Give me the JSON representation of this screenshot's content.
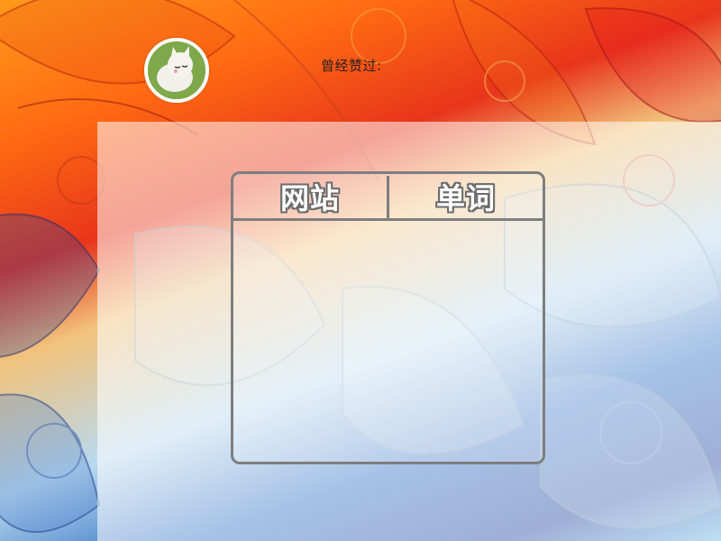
{
  "profile": {
    "liked_label": "曾经赞过:"
  },
  "tabs": [
    {
      "label": "网站"
    },
    {
      "label": "单词"
    }
  ],
  "colors": {
    "panel_border": "#7e7e7e",
    "avatar_border": "#ffffff",
    "overlay": "rgba(255,255,255,0.55)"
  },
  "icons": {
    "avatar": "white-cat-avatar-icon"
  }
}
